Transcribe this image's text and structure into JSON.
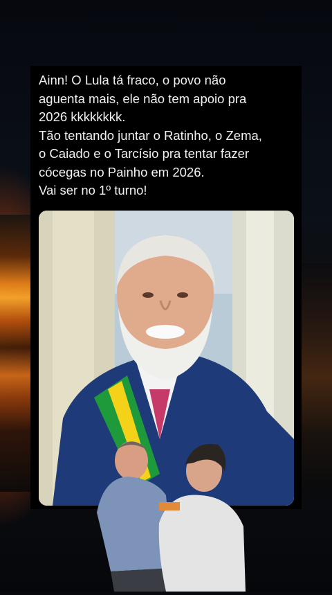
{
  "tweet": {
    "lines": [
      "Ainn! O Lula tá fraco, o povo não",
      "aguenta mais, ele não tem apoio pra",
      "2026 kkkkkkkk.",
      "Tão tentando juntar o Ratinho, o Zema,",
      "o Caiado e o Tarcísio pra tentar fazer",
      "cócegas no Painho em 2026.",
      "Vai ser no 1º turno!"
    ]
  },
  "colors": {
    "sash_green": "#1f9a3a",
    "sash_yellow": "#f4d21a",
    "suit_blue": "#1e3a78",
    "tie_pink": "#c63a6a",
    "sunset_orange": "#f0901e"
  }
}
